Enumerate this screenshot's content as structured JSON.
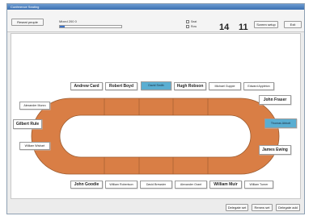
{
  "window": {
    "title": "Conference Seating"
  },
  "toolbar": {
    "seat_button": "Reseat people",
    "slider": {
      "label": "Mixed 200 0",
      "value_fraction": 0.08
    },
    "checks": [
      "Seat",
      "Row"
    ],
    "count_a": "14",
    "count_b": "11",
    "screen_button": "Screen setup",
    "exit_button": "Exit"
  },
  "seats": {
    "top": [
      "Andrew Card",
      "Robert Boyd",
      "David Smith",
      "Hugh Robson",
      "Michael Guppie",
      "Edward Appleton"
    ],
    "left": [
      "Alexander Munro",
      "Gilbert Rule",
      "William Wishart"
    ],
    "right": [
      "John Fraser",
      "Thomas Abbott",
      "James Ewing"
    ],
    "bottom": [
      "John Goodie",
      "William Robertson",
      "David Brewster",
      "Alexander Grant",
      "William Muir",
      "William Turner"
    ]
  },
  "statusbar": {
    "buttons": [
      "Delegate set",
      "Renew set",
      "Delegate add"
    ]
  },
  "colors": {
    "table_fill": "#d97e45",
    "table_edge": "#9a5a2e",
    "selected": "#5aaed2"
  }
}
